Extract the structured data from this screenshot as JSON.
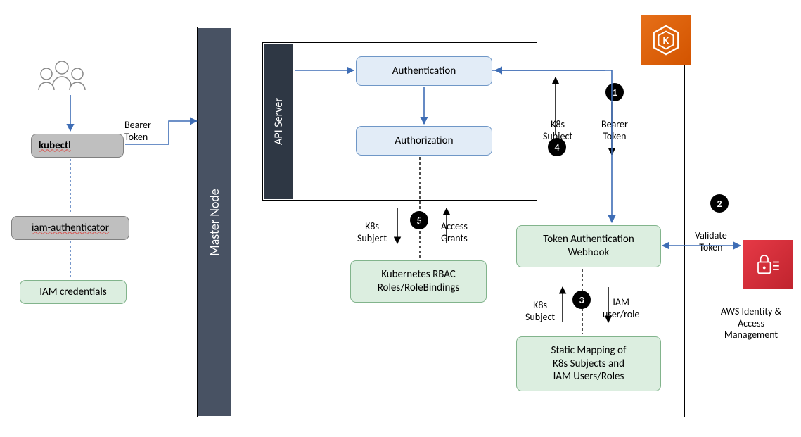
{
  "left": {
    "kubectl": "kubectl",
    "iamAuthenticator": "iam-authenticator",
    "iamCredentials": "IAM credentials",
    "bearerToken": "Bearer\nToken"
  },
  "master": {
    "title": "Master Node",
    "apiServer": "API Server",
    "authentication": "Authentication",
    "authorization": "Authorization",
    "rbac": "Kubernetes RBAC\nRoles/RoleBindings",
    "tokenWebhook": "Token Authentication\nWebhook",
    "staticMapping": "Static Mapping of\nK8s Subjects and\nIAM Users/Roles"
  },
  "labels": {
    "k8sSubject5": "K8s\nSubject",
    "accessGrants": "Access\nGrants",
    "k8sSubject4": "K8s\nSubject",
    "bearerToken1": "Bearer\nToken",
    "k8sSubject3": "K8s\nSubject",
    "iamUserRole": "IAM\nuser/role",
    "validateToken": "Validate\nToken",
    "awsIam": "AWS Identity &\nAccess\nManagement"
  },
  "badges": {
    "b1": "1",
    "b2": "2",
    "b3": "3",
    "b4": "4",
    "b5": "5"
  }
}
